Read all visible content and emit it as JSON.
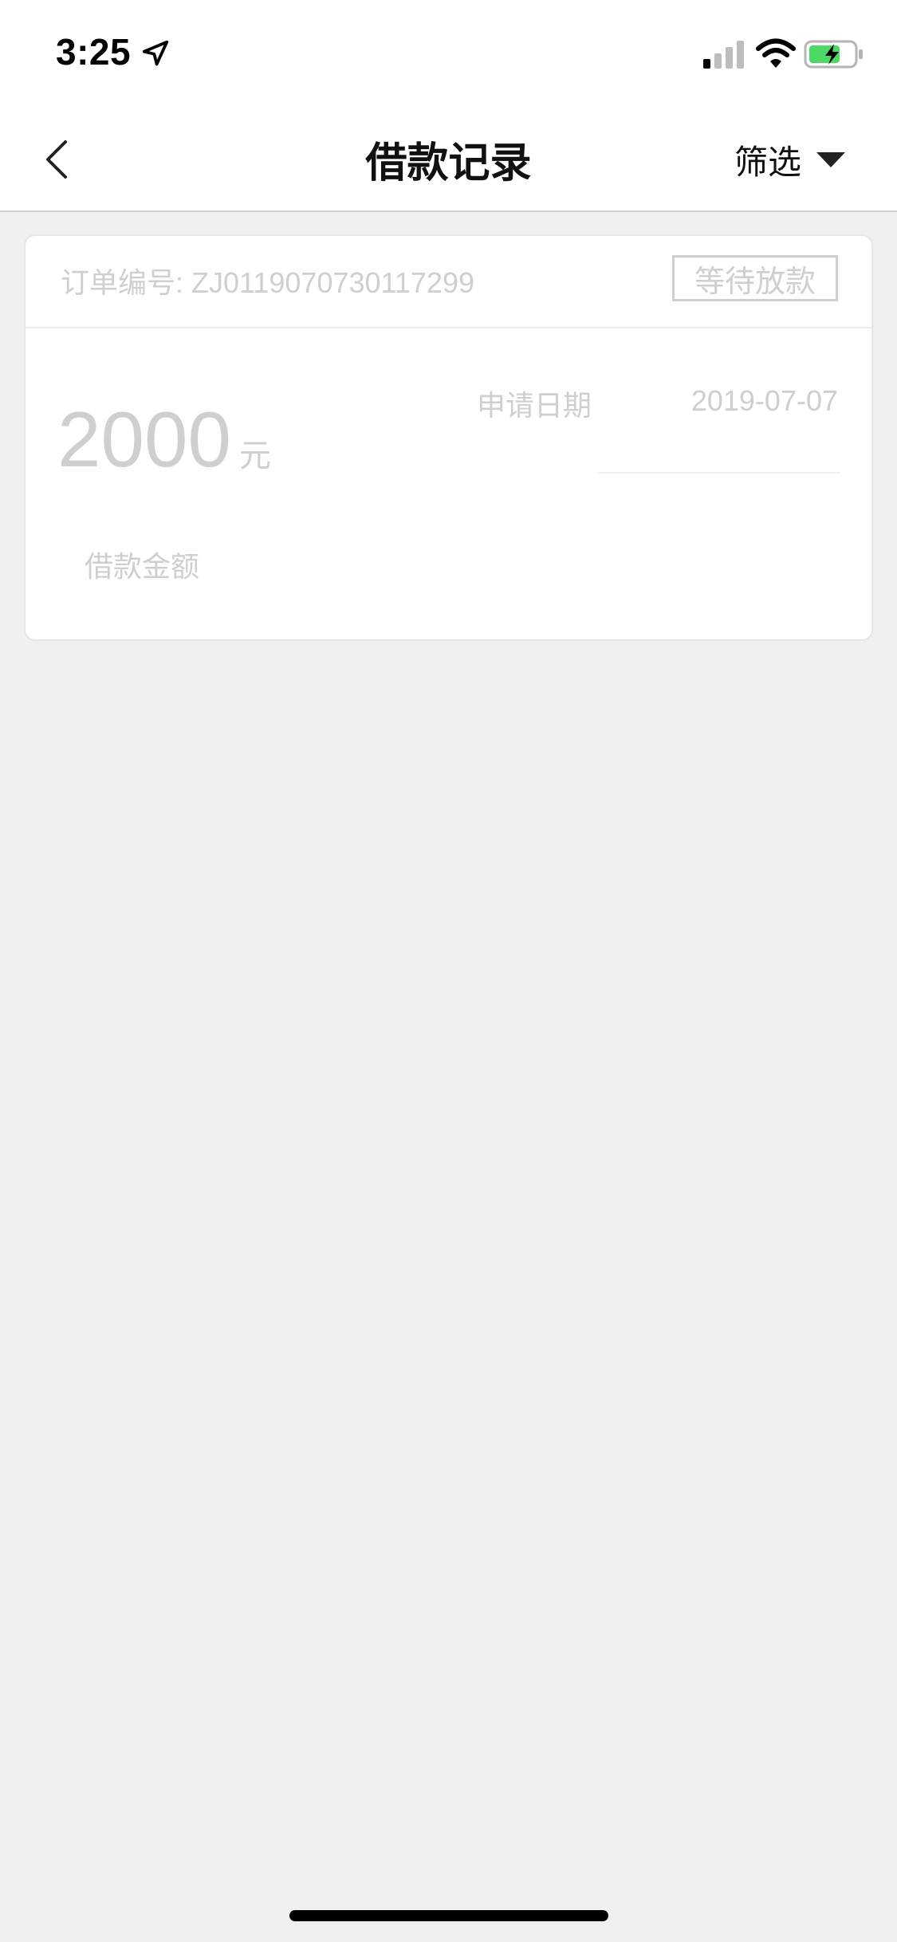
{
  "status_bar": {
    "time": "3:25",
    "icons": [
      "location-arrow-icon",
      "cellular-signal-icon",
      "wifi-icon",
      "battery-charging-icon"
    ],
    "battery_color": "#4cd964"
  },
  "nav": {
    "title": "借款记录",
    "filter_label": "筛选",
    "icons": [
      "chevron-left-icon",
      "caret-down-icon"
    ]
  },
  "record": {
    "order_no": "订单编号: ZJ0119070730117299",
    "status": "等待放款",
    "amount": "2000",
    "amount_unit": "元",
    "amount_label": "借款金额",
    "date_label": "申请日期",
    "date_value": "2019-07-07"
  },
  "colors": {
    "background": "#f0f0f0",
    "card": "#ffffff",
    "muted_text": "#cfcfcf",
    "title_text": "#111111"
  }
}
